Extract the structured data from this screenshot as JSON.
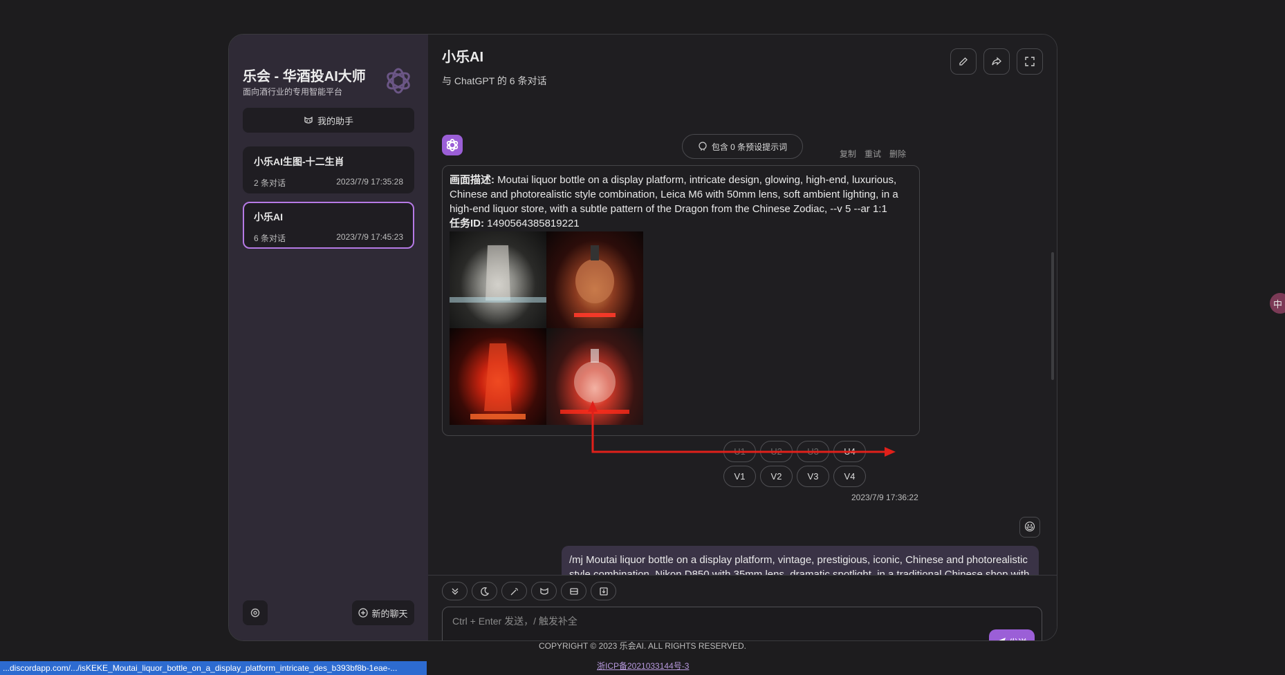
{
  "sidebar": {
    "brand_title": "乐会 - 华酒投AI大师",
    "brand_subtitle": "面向酒行业的专用智能平台",
    "my_assistant_label": "我的助手",
    "chats": [
      {
        "title": "小乐AI生图-十二生肖",
        "count": "2 条对话",
        "time": "2023/7/9 17:35:28"
      },
      {
        "title": "小乐AI",
        "count": "6 条对话",
        "time": "2023/7/9 17:45:23"
      }
    ],
    "new_chat_label": "新的聊天"
  },
  "header": {
    "title": "小乐AI",
    "subtitle": "与 ChatGPT 的 6 条对话"
  },
  "message": {
    "preset_label": "包含 0 条预设提示词",
    "actions": {
      "copy": "复制",
      "retry": "重试",
      "delete": "删除"
    },
    "desc_label": "画面描述:",
    "desc_text": " Moutai liquor bottle on a display platform, intricate design, glowing, high-end, luxurious, Chinese and photorealistic style combination, Leica M6 with 50mm lens, soft ambient lighting, in a high-end liquor store, with a subtle pattern of the Dragon from the Chinese Zodiac, --v 5 --ar 1:1",
    "task_label": "任务ID:",
    "task_id": " 1490564385819221",
    "u_buttons": [
      "U1",
      "U2",
      "U3",
      "U4"
    ],
    "v_buttons": [
      "V1",
      "V2",
      "V3",
      "V4"
    ],
    "timestamp": "2023/7/9 17:36:22"
  },
  "user_message": {
    "avatar": "😃",
    "text": "/mj Moutai liquor bottle on a display platform, vintage, prestigious, iconic, Chinese and photorealistic style combination, Nikon D850 with 35mm lens, dramatic spotlight, in a traditional Chinese shop with"
  },
  "composer": {
    "placeholder": "Ctrl + Enter 发送，/ 触发补全",
    "send_label": "发送"
  },
  "footer": {
    "copyright": "COPYRIGHT © 2023 乐会AI. ALL RIGHTS RESERVED.",
    "icp": "浙ICP备2021033144号-3"
  },
  "status_url": "...discordapp.com/.../isKEKE_Moutai_liquor_bottle_on_a_display_platform_intricate_des_b393bf8b-1eae-...",
  "edge_widget_label": "中",
  "colors": {
    "accent": "#9b5fd7",
    "arrow": "#e0201a",
    "sidebar": "#2f2a36"
  },
  "icons": [
    "openai-logo-icon",
    "mask-icon",
    "settings-icon",
    "plus-circle-icon",
    "edit-icon",
    "share-icon",
    "fullscreen-icon",
    "send-icon"
  ]
}
